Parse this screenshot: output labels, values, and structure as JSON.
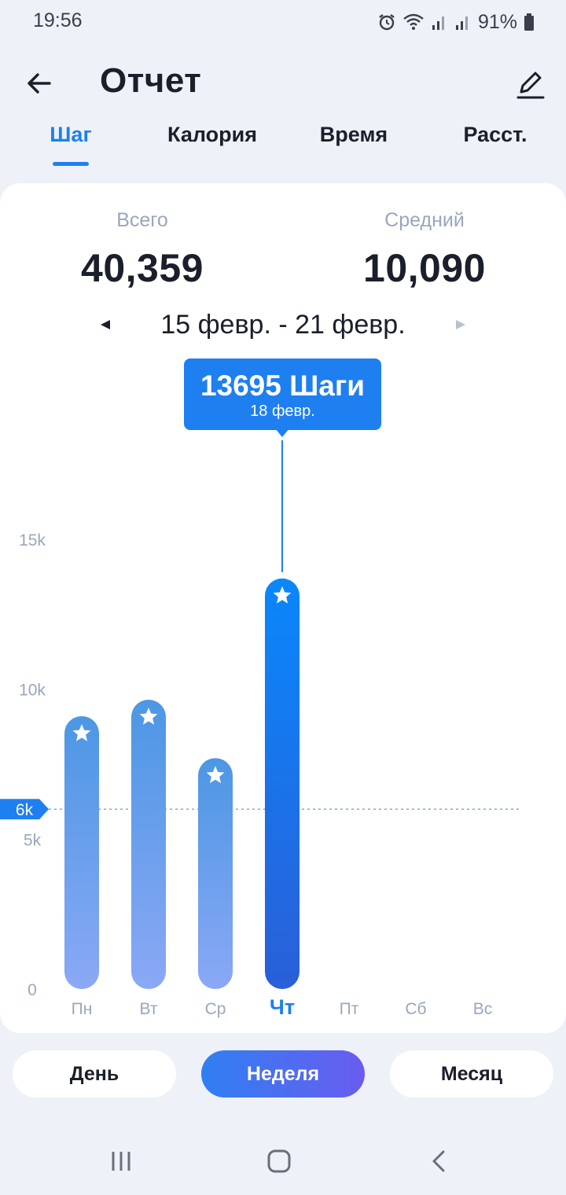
{
  "status": {
    "time": "19:56",
    "battery": "91%"
  },
  "header": {
    "title": "Отчет",
    "back_icon": "arrow-left-icon",
    "edit_icon": "pencil-icon"
  },
  "tabs": [
    {
      "label": "Шаг",
      "active": true
    },
    {
      "label": "Калория",
      "active": false
    },
    {
      "label": "Время",
      "active": false
    },
    {
      "label": "Расст.",
      "active": false
    }
  ],
  "summary": {
    "total_label": "Всего",
    "total_value": "40,359",
    "average_label": "Средний",
    "average_value": "10,090"
  },
  "range": {
    "text": "15 февр. - 21 февр."
  },
  "tooltip": {
    "main": "13695 Шаги",
    "sub": "18 февр."
  },
  "colors": {
    "accent": "#1e7ff0",
    "bar_light_top": "#4c97e4",
    "bar_light_bottom": "#8aa8f5",
    "bar_active_top": "#0a87fb",
    "bar_active_bottom": "#2a5fd8"
  },
  "bottom_tabs": [
    {
      "label": "День",
      "active": false
    },
    {
      "label": "Неделя",
      "active": true
    },
    {
      "label": "Месяц",
      "active": false
    }
  ],
  "chart_data": {
    "type": "bar",
    "categories": [
      "Пн",
      "Вт",
      "Ср",
      "Чт",
      "Пт",
      "Сб",
      "Вс"
    ],
    "values": [
      9100,
      9650,
      7700,
      13695,
      0,
      0,
      0
    ],
    "selected_index": 3,
    "y_ticks": [
      {
        "value": 0,
        "label": "0"
      },
      {
        "value": 5000,
        "label": "5k"
      },
      {
        "value": 10000,
        "label": "10k"
      },
      {
        "value": 15000,
        "label": "15k"
      }
    ],
    "goal": {
      "value": 6000,
      "label": "6k"
    },
    "ylim": [
      0,
      15000
    ],
    "grid": false
  }
}
